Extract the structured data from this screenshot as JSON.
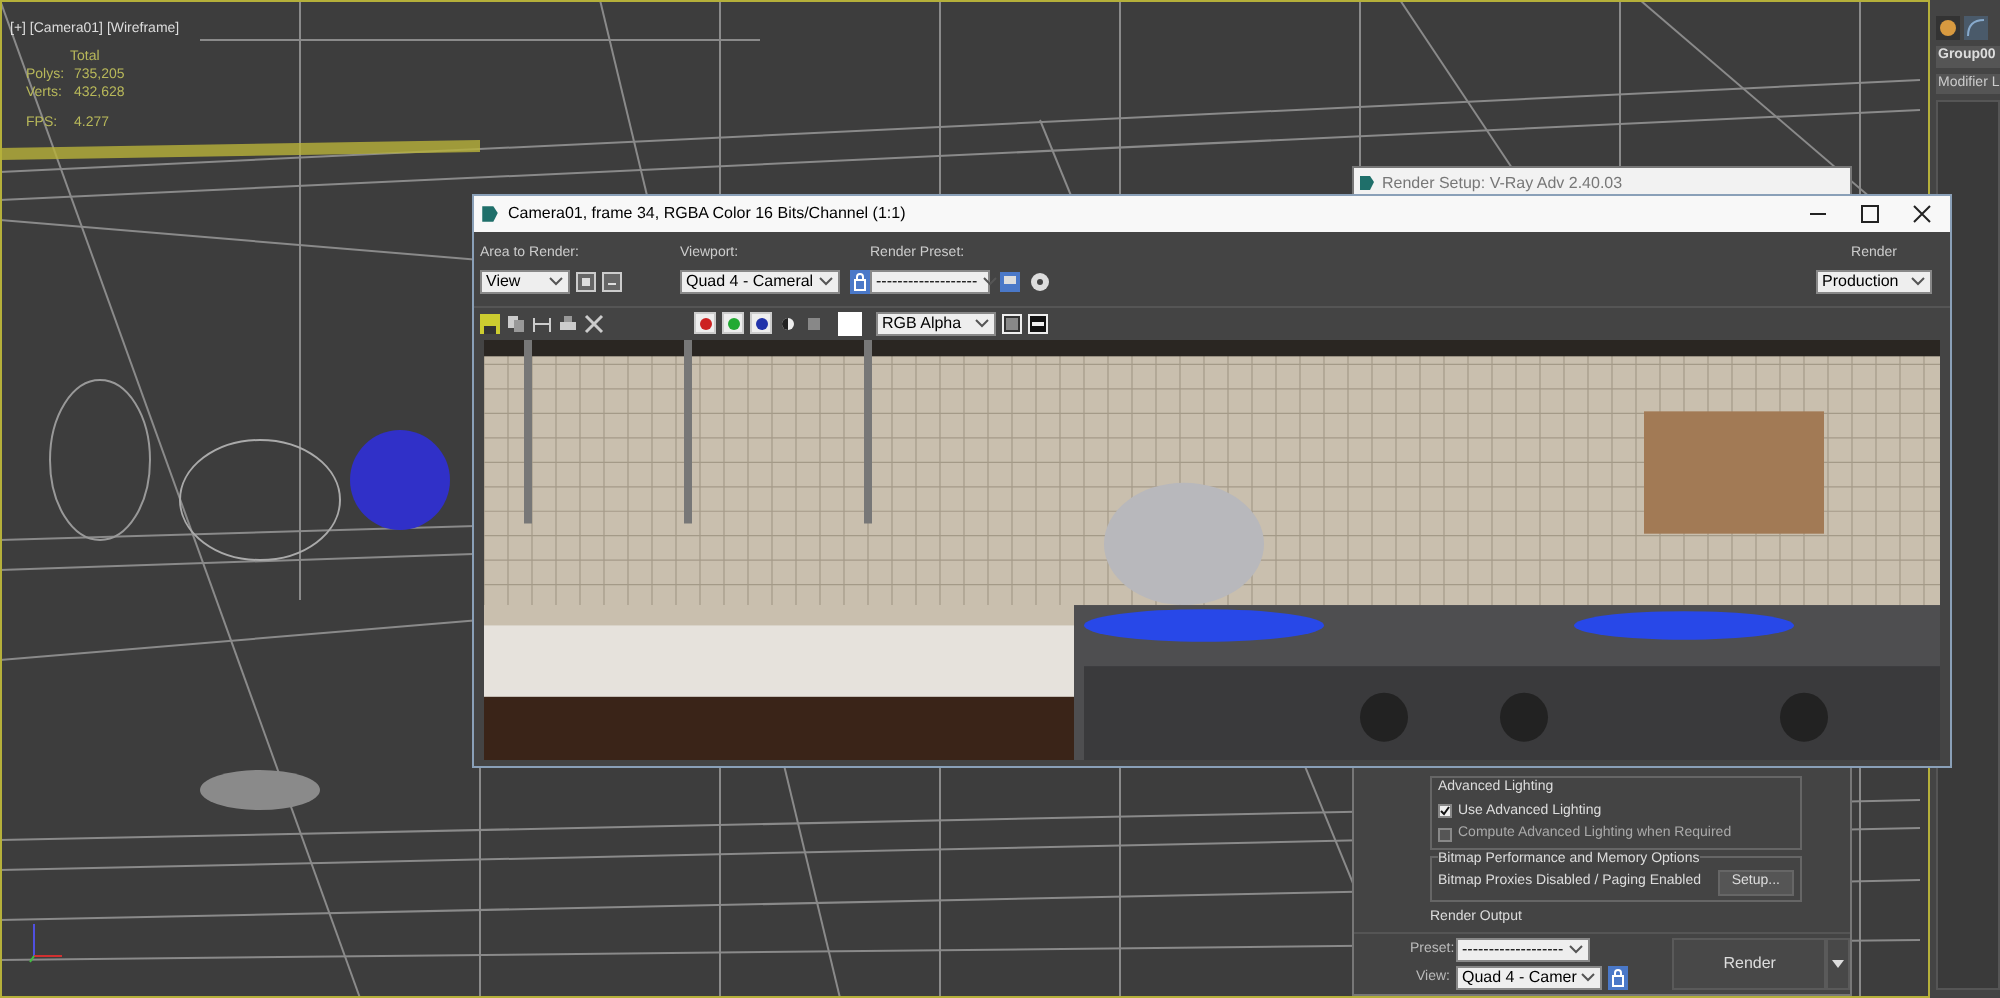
{
  "viewport": {
    "label": "[+] [Camera01] [Wireframe]",
    "stats_header": "Total",
    "stats": [
      {
        "name": "Polys:",
        "value": "735,205"
      },
      {
        "name": "Verts:",
        "value": "432,628"
      },
      {
        "name": "FPS:",
        "value": "4.277"
      }
    ]
  },
  "command_panel": {
    "object_name": "Group00",
    "modifier_list": "Modifier L"
  },
  "render_setup": {
    "title": "Render Setup: V-Ray Adv 2.40.03",
    "advanced_lighting": {
      "title": "Advanced Lighting",
      "options": [
        {
          "label": "Use Advanced Lighting",
          "checked": true
        },
        {
          "label": "Compute Advanced Lighting when Required",
          "checked": false
        }
      ]
    },
    "bitmap": {
      "title": "Bitmap Performance and Memory Options",
      "status": "Bitmap Proxies Disabled / Paging Enabled",
      "button": "Setup..."
    },
    "render_output": {
      "title": "Render Output"
    },
    "preset_label": "Preset:",
    "preset": "-------------------",
    "view_label": "View:",
    "view": "Quad 4 - Camer",
    "render_button": "Render"
  },
  "frame_window": {
    "title": "Camera01, frame 34, RGBA Color 16 Bits/Channel (1:1)",
    "area_label": "Area to Render:",
    "area": "View",
    "viewport_label": "Viewport:",
    "viewport": "Quad 4 - Cameral",
    "preset_label": "Render Preset:",
    "preset": "-------------------",
    "render_label": "Render",
    "render_target": "Production",
    "channel_buttons": [
      {
        "color": "#cc2222",
        "on": true
      },
      {
        "color": "#22aa33",
        "on": true
      },
      {
        "color": "#2233aa",
        "on": true
      }
    ],
    "channel": "RGB Alpha"
  }
}
